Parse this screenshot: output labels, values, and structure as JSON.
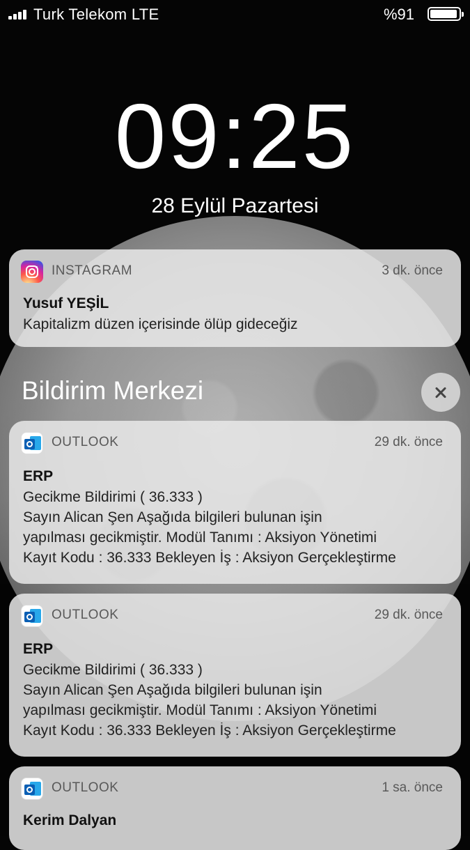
{
  "status_bar": {
    "carrier": "Turk Telekom  LTE",
    "battery": "%91",
    "battery_level": 0.91
  },
  "lock_screen": {
    "time": "09:25",
    "date": "28 Eylül Pazartesi"
  },
  "notification_center": {
    "title": "Bildirim Merkezi"
  },
  "notifications": [
    {
      "app": "INSTAGRAM",
      "icon": "instagram-icon",
      "time": "3 dk. önce",
      "title": "Yusuf YEŞİL",
      "lines": [
        "Kapitalizm düzen içerisinde ölüp gideceğiz"
      ]
    },
    {
      "app": "OUTLOOK",
      "icon": "outlook-icon",
      "time": "29 dk. önce",
      "title": "ERP",
      "lines": [
        "Gecikme Bildirimi ( 36.333 )",
        "Sayın Alican Şen Aşağıda bilgileri bulunan işin",
        "yapılması gecikmiştir. Modül Tanımı : Aksiyon Yönetimi",
        "Kayıt Kodu : 36.333 Bekleyen İş : Aksiyon Gerçekleştirme"
      ]
    },
    {
      "app": "OUTLOOK",
      "icon": "outlook-icon",
      "time": "29 dk. önce",
      "title": "ERP",
      "lines": [
        "Gecikme Bildirimi ( 36.333 )",
        "Sayın Alican Şen Aşağıda bilgileri bulunan işin",
        "yapılması gecikmiştir. Modül Tanımı : Aksiyon Yönetimi",
        "Kayıt Kodu : 36.333 Bekleyen İş : Aksiyon Gerçekleştirme"
      ]
    },
    {
      "app": "OUTLOOK",
      "icon": "outlook-icon",
      "time": "1 sa. önce",
      "title": "Kerim Dalyan",
      "lines": []
    }
  ]
}
